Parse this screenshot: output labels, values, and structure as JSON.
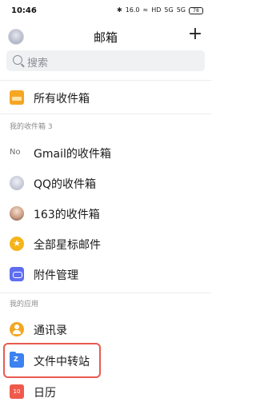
{
  "status_bar": {
    "time": "10:46",
    "bluetooth": "✱",
    "speed": "16.0",
    "wifi": "≈",
    "hd": "HD",
    "signal1": "5G",
    "signal2": "5G",
    "battery": "78"
  },
  "header": {
    "title": "邮箱",
    "add_label": "+"
  },
  "search": {
    "placeholder": "搜索"
  },
  "items": {
    "all_inbox": "所有收件箱"
  },
  "sections": {
    "my_inboxes": "我的收件箱 3",
    "my_apps": "我的应用"
  },
  "accounts": [
    {
      "label": "Gmail的收件箱",
      "icon_text": "No",
      "icon": "gmail-icon"
    },
    {
      "label": "QQ的收件箱",
      "icon": "qq-avatar-icon"
    },
    {
      "label": "163的收件箱",
      "icon": "163-avatar-icon"
    },
    {
      "label": "全部星标邮件",
      "icon_text": "★",
      "icon": "star-icon"
    },
    {
      "label": "附件管理",
      "icon": "attachment-icon"
    }
  ],
  "apps": [
    {
      "label": "通讯录",
      "icon": "contacts-icon"
    },
    {
      "label": "文件中转站",
      "icon": "file-transfer-icon"
    },
    {
      "label": "日历",
      "icon_text": "10",
      "icon": "calendar-icon"
    }
  ],
  "colors": {
    "accent_orange": "#f5a623",
    "highlight_red": "#e85a4f",
    "folder_blue": "#3c82f0",
    "attachment_purple": "#5f6ef0",
    "calendar_red": "#f05a4a"
  }
}
